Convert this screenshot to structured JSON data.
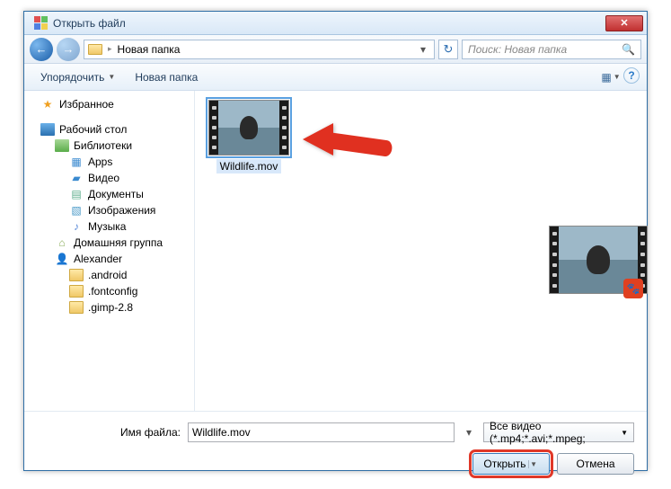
{
  "titlebar": {
    "title": "Открыть файл",
    "close": "✕"
  },
  "nav": {
    "back": "←",
    "forward": "→",
    "path_sep": "▸",
    "location": "Новая папка",
    "dropdown": "▾",
    "refresh": "↻"
  },
  "search": {
    "placeholder": "Поиск: Новая папка",
    "icon": "🔍"
  },
  "toolbar": {
    "organize": "Упорядочить",
    "new_folder": "Новая папка",
    "arrow": "▼",
    "view_ic": "▦",
    "help_ic": "?"
  },
  "sidebar": {
    "favorites": "Избранное",
    "desktop": "Рабочий стол",
    "libraries": "Библиотеки",
    "apps": "Apps",
    "video": "Видео",
    "documents": "Документы",
    "images": "Изображения",
    "music": "Музыка",
    "homegroup": "Домашняя группа",
    "user": "Alexander",
    "f_android": ".android",
    "f_fontconfig": ".fontconfig",
    "f_gimp": ".gimp-2.8"
  },
  "content": {
    "file1": "Wildlife.mov",
    "badge": "🐾"
  },
  "footer": {
    "filename_label": "Имя файла:",
    "filename_value": "Wildlife.mov",
    "filter": "Все видео (*.mp4;*.avi;*.mpeg;",
    "filter_arrow": "▼",
    "open": "Открыть",
    "open_split": "▼",
    "cancel": "Отмена"
  }
}
